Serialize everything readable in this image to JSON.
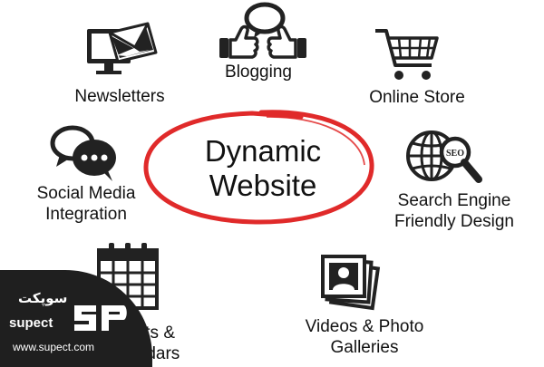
{
  "center": {
    "line1": "Dynamic",
    "line2": "Website"
  },
  "features": {
    "newsletters": "Newsletters",
    "blogging": "Blogging",
    "online_store": "Online Store",
    "social_line1": "Social Media",
    "social_line2": "Integration",
    "seo_line1": "Search Engine",
    "seo_line2": "Friendly Design",
    "events_line1": "Events &",
    "events_line2": "Calendars",
    "videos_line1": "Videos & Photo",
    "videos_line2": "Galleries",
    "seo_badge": "SEO"
  },
  "watermark": {
    "arabic": "سوپکت",
    "brand": "supect",
    "url": "www.supect.com"
  },
  "icons": [
    "monitor-envelope-icon",
    "thumbs-up-icon",
    "shopping-cart-icon",
    "chat-bubbles-icon",
    "globe-magnifier-icon",
    "calendar-icon",
    "photo-stack-icon",
    "supect-logo-icon"
  ],
  "colors": {
    "ring": "#e02a2a",
    "ink": "#111111",
    "watermark_bg": "#1f1f1f"
  }
}
